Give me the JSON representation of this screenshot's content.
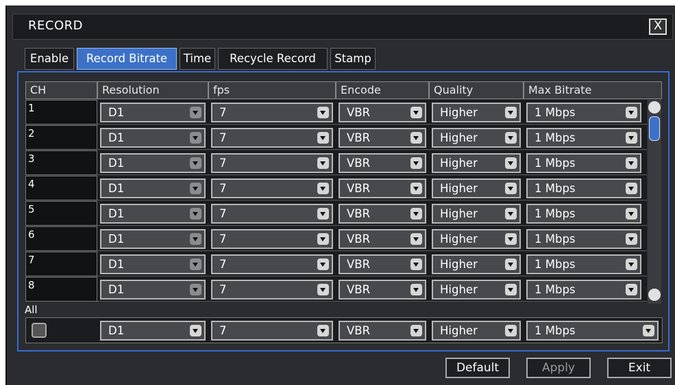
{
  "window": {
    "title": "RECORD",
    "close_label": "X"
  },
  "tabs": [
    {
      "label": "Enable",
      "active": false
    },
    {
      "label": "Record Bitrate",
      "active": true
    },
    {
      "label": "Time",
      "active": false
    },
    {
      "label": "Recycle Record",
      "active": false
    },
    {
      "label": "Stamp",
      "active": false
    }
  ],
  "table": {
    "headers": [
      "CH",
      "Resolution",
      "fps",
      "Encode",
      "Quality",
      "Max Bitrate"
    ],
    "rows": [
      {
        "ch": "1",
        "resolution": "D1",
        "fps": "7",
        "encode": "VBR",
        "quality": "Higher",
        "max_bitrate": "1 Mbps"
      },
      {
        "ch": "2",
        "resolution": "D1",
        "fps": "7",
        "encode": "VBR",
        "quality": "Higher",
        "max_bitrate": "1 Mbps"
      },
      {
        "ch": "3",
        "resolution": "D1",
        "fps": "7",
        "encode": "VBR",
        "quality": "Higher",
        "max_bitrate": "1 Mbps"
      },
      {
        "ch": "4",
        "resolution": "D1",
        "fps": "7",
        "encode": "VBR",
        "quality": "Higher",
        "max_bitrate": "1 Mbps"
      },
      {
        "ch": "5",
        "resolution": "D1",
        "fps": "7",
        "encode": "VBR",
        "quality": "Higher",
        "max_bitrate": "1 Mbps"
      },
      {
        "ch": "6",
        "resolution": "D1",
        "fps": "7",
        "encode": "VBR",
        "quality": "Higher",
        "max_bitrate": "1 Mbps"
      },
      {
        "ch": "7",
        "resolution": "D1",
        "fps": "7",
        "encode": "VBR",
        "quality": "Higher",
        "max_bitrate": "1 Mbps"
      },
      {
        "ch": "8",
        "resolution": "D1",
        "fps": "7",
        "encode": "VBR",
        "quality": "Higher",
        "max_bitrate": "1 Mbps"
      }
    ],
    "all": {
      "label": "All",
      "resolution": "D1",
      "fps": "7",
      "encode": "VBR",
      "quality": "Higher",
      "max_bitrate": "1 Mbps"
    }
  },
  "buttons": {
    "default": "Default",
    "apply": "Apply",
    "exit": "Exit"
  },
  "colors": {
    "accent": "#3d71c8",
    "background": "#2a2c30"
  }
}
